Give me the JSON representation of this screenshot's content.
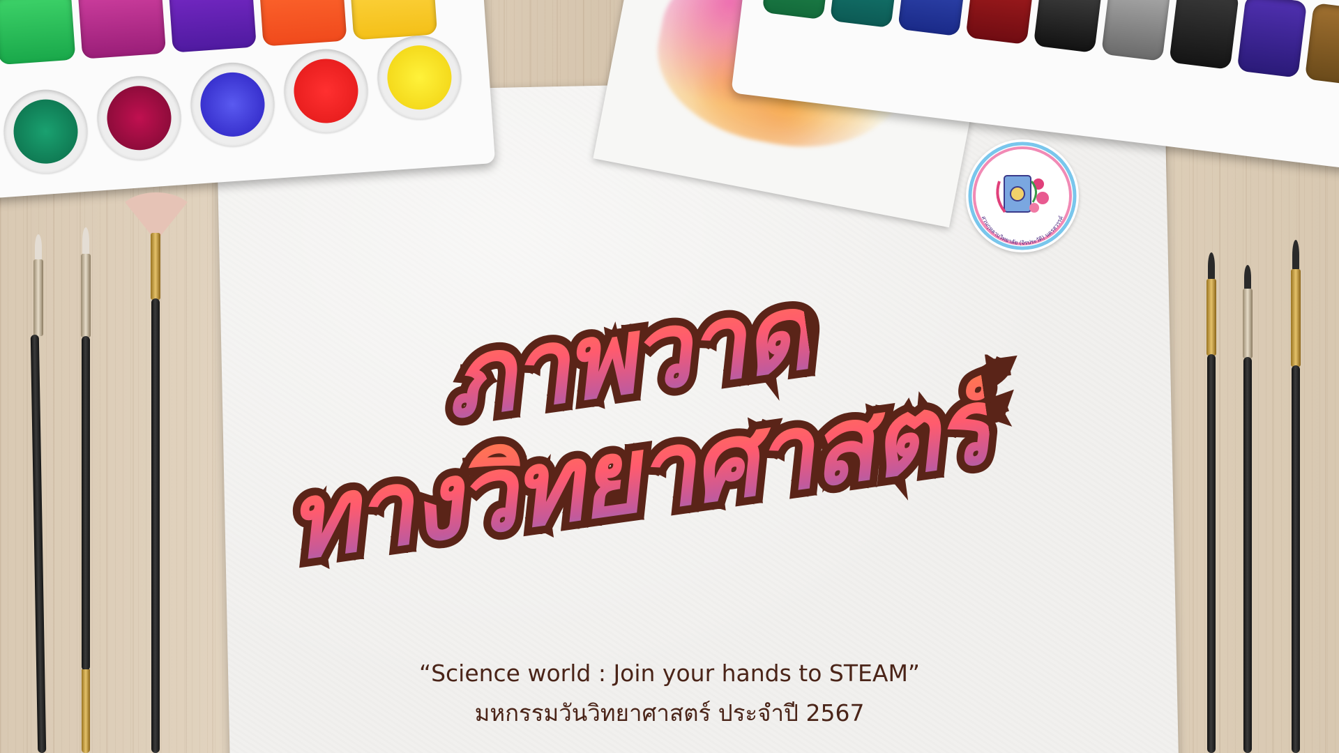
{
  "title": {
    "line1": "ภาพวาด",
    "line2": "ทางวิทยาศาสตร์"
  },
  "slogan": "“Science world : Join your hands to STEAM”",
  "event": "มหกรรมวันวิทยาศาสตร์ ประจำปี 2567",
  "logo": {
    "top_text": "สวนกุหลาบวิทยาลัย (จิรประวัติ) นครสวรรค์",
    "bottom_text": "Suankularb Wittayalai (Jiraprawat) Nakhon Sawan"
  },
  "colors": {
    "title_gradient": [
      "#ff8a3c",
      "#ff5b6e",
      "#c35a9b",
      "#4f8de8"
    ],
    "title_outline": "#5a2418",
    "footer_text": "#4a2418"
  }
}
